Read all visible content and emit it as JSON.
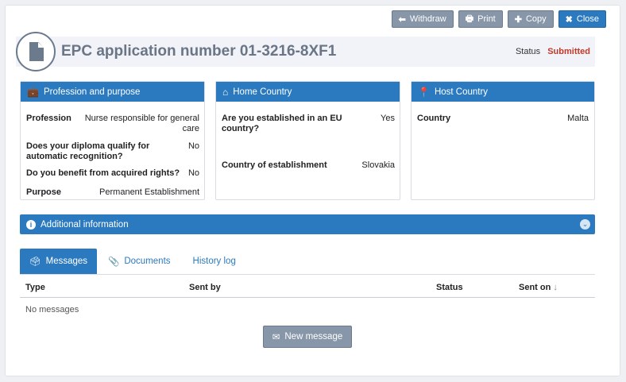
{
  "toolbar": {
    "withdraw": {
      "label": "Withdraw",
      "icon": "arrow-left-icon"
    },
    "print": {
      "label": "Print",
      "icon": "printer-icon"
    },
    "copy": {
      "label": "Copy",
      "icon": "plus-icon"
    },
    "close": {
      "label": "Close",
      "icon": "close-icon"
    }
  },
  "header": {
    "title": "EPC application number 01-3216-8XF1",
    "status_label": "Status",
    "status_value": "Submitted",
    "status_color": "#c0392b"
  },
  "panels": {
    "profession": {
      "title": "Profession and purpose",
      "rows": [
        {
          "key": "Profession",
          "value": "Nurse responsible for general care"
        },
        {
          "key": "Does your diploma qualify for automatic recognition?",
          "value": "No"
        },
        {
          "key": "Do you benefit from acquired rights?",
          "value": "No"
        },
        {
          "key": "Purpose",
          "value": "Permanent Establishment"
        }
      ]
    },
    "home": {
      "title": "Home Country",
      "rows": [
        {
          "key": "Are you established in an EU country?",
          "value": "Yes"
        },
        {
          "key": "Country of establishment",
          "value": "Slovakia"
        }
      ]
    },
    "host": {
      "title": "Host Country",
      "rows": [
        {
          "key": "Country",
          "value": "Malta"
        }
      ]
    }
  },
  "additional": {
    "title": "Additional information"
  },
  "tabs": [
    {
      "label": "Messages",
      "active": true
    },
    {
      "label": "Documents",
      "active": false
    },
    {
      "label": "History log",
      "active": false
    }
  ],
  "table": {
    "columns": [
      "Type",
      "Sent by",
      "Status",
      "Sent on"
    ],
    "sort_indicator": "↓",
    "empty_text": "No messages"
  },
  "new_message": {
    "label": "New message"
  },
  "colors": {
    "primary": "#2b7ac0",
    "secondary": "#8796a8"
  }
}
